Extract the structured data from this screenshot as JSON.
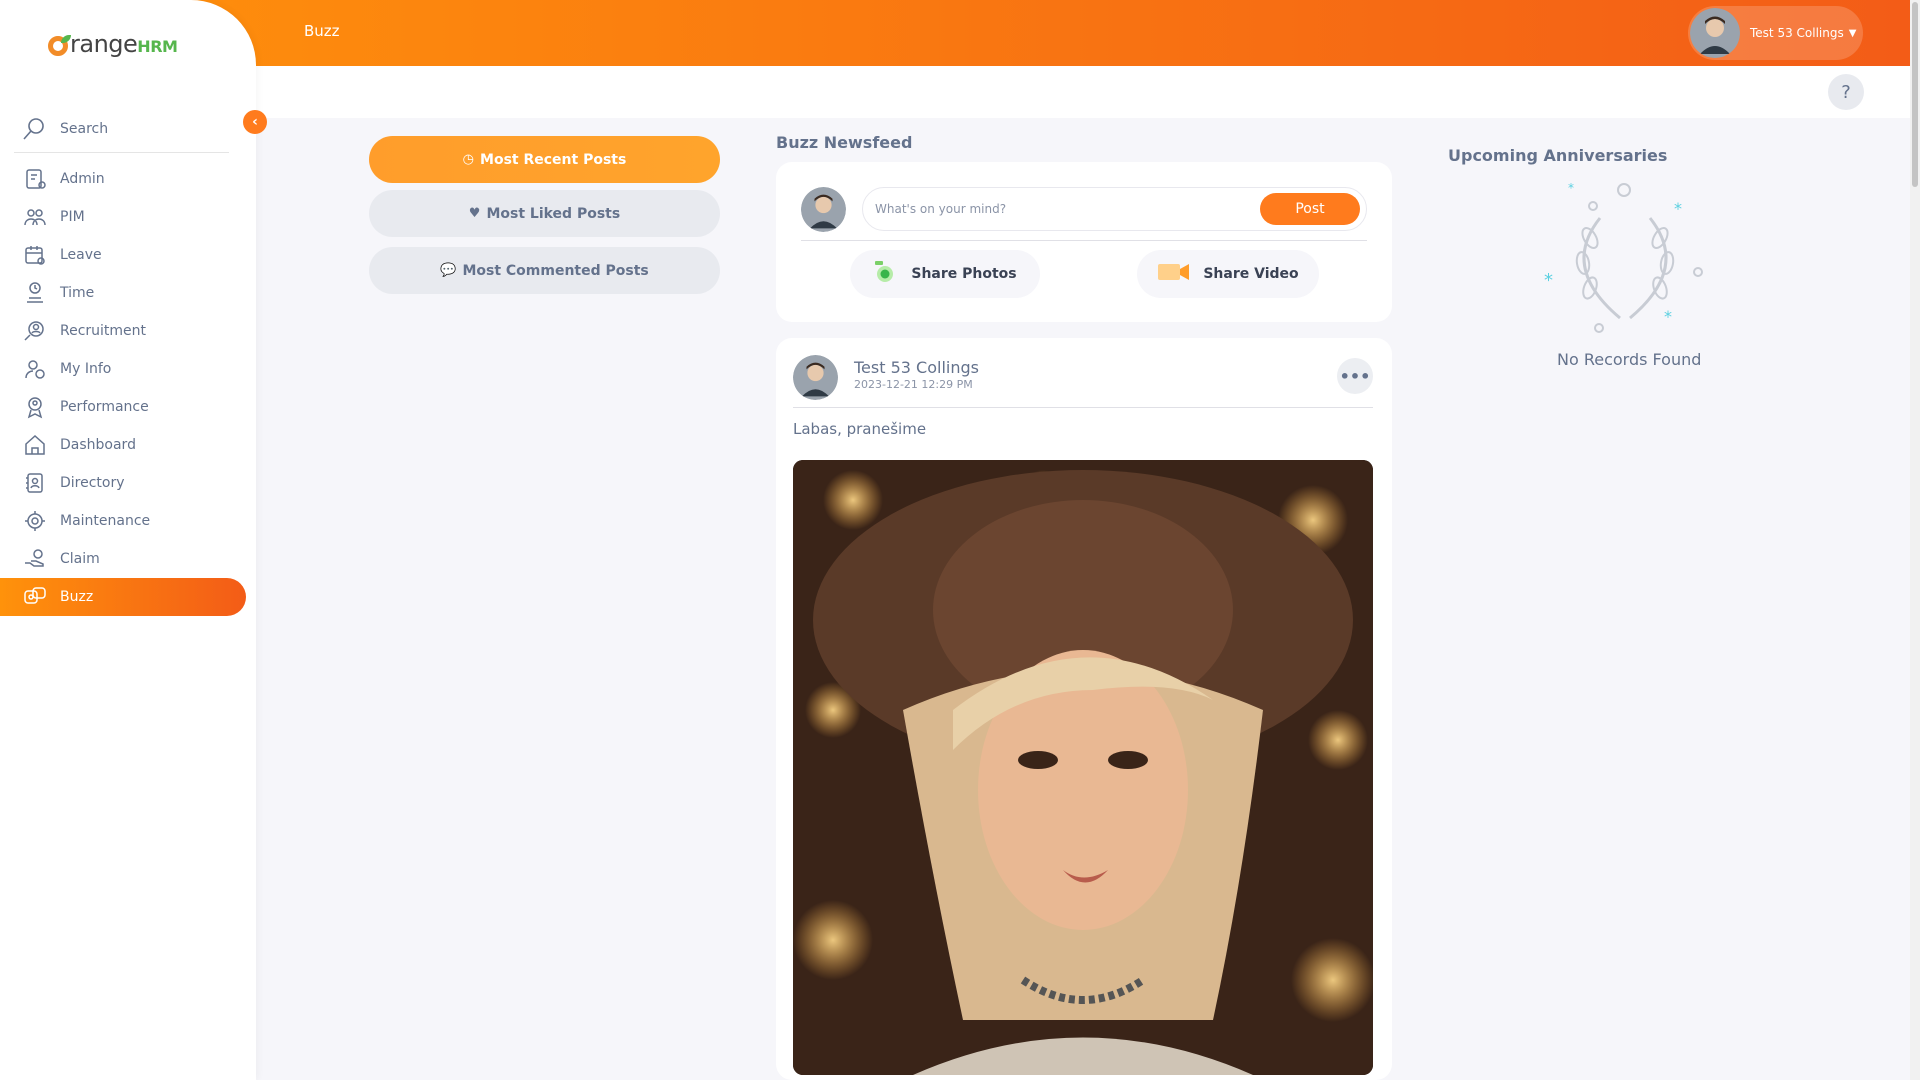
{
  "brand": {
    "name": "range",
    "suffix": "HRM"
  },
  "search": {
    "label": "Search"
  },
  "menu": [
    {
      "label": "Admin",
      "icon": "admin-icon"
    },
    {
      "label": "PIM",
      "icon": "pim-icon"
    },
    {
      "label": "Leave",
      "icon": "leave-icon"
    },
    {
      "label": "Time",
      "icon": "time-icon"
    },
    {
      "label": "Recruitment",
      "icon": "recruitment-icon"
    },
    {
      "label": "My Info",
      "icon": "my-info-icon"
    },
    {
      "label": "Performance",
      "icon": "performance-icon"
    },
    {
      "label": "Dashboard",
      "icon": "dashboard-icon"
    },
    {
      "label": "Directory",
      "icon": "directory-icon"
    },
    {
      "label": "Maintenance",
      "icon": "maintenance-icon"
    },
    {
      "label": "Claim",
      "icon": "claim-icon"
    },
    {
      "label": "Buzz",
      "icon": "buzz-icon",
      "active": true
    }
  ],
  "topbar": {
    "module": "Buzz",
    "user_name": "Test 53 Collings",
    "help": "?"
  },
  "filters": {
    "recent": "Most Recent Posts",
    "liked": "Most Liked Posts",
    "commented": "Most Commented Posts"
  },
  "newsfeed": {
    "title": "Buzz Newsfeed",
    "placeholder": "What's on your mind?",
    "post_button": "Post",
    "share_photos": "Share Photos",
    "share_video": "Share Video"
  },
  "post": {
    "author": "Test 53 Collings",
    "date": "2023-12-21 12:29 PM",
    "text": "Labas, pranešime",
    "more": "•••"
  },
  "anniversaries": {
    "title": "Upcoming Anniversaries",
    "empty": "No Records Found"
  },
  "colors": {
    "accent": "#ff7b1d",
    "gradient_start": "#ff920b",
    "gradient_end": "#f35c17",
    "text": "#64728c"
  }
}
